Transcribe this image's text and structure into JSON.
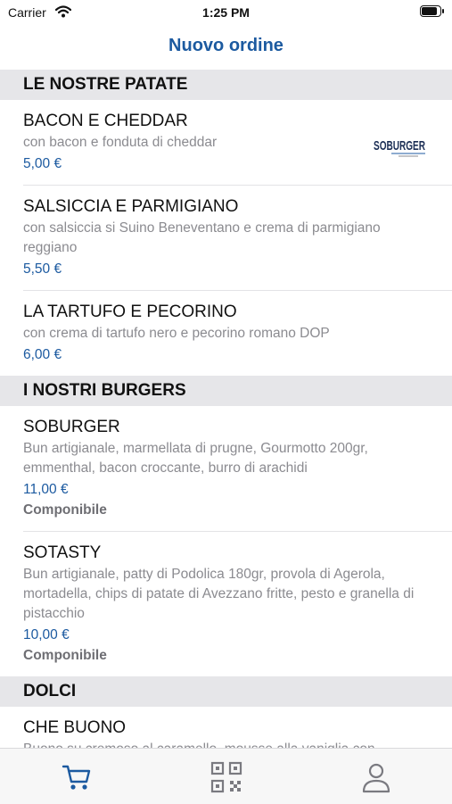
{
  "status": {
    "carrier": "Carrier",
    "time": "1:25 PM"
  },
  "nav": {
    "title": "Nuovo ordine"
  },
  "sections": [
    {
      "title": "LE NOSTRE PATATE",
      "items": [
        {
          "name": "BACON E CHEDDAR",
          "description": "con bacon e fonduta di cheddar",
          "price": "5,00 €",
          "logo": "SOBURGER"
        },
        {
          "name": "SALSICCIA E PARMIGIANO",
          "description": "con salsiccia si Suino Beneventano e crema di parmigiano reggiano",
          "price": "5,50 €"
        },
        {
          "name": "LA TARTUFO E PECORINO",
          "description": "con crema di tartufo nero e pecorino romano DOP",
          "price": "6,00 €"
        }
      ]
    },
    {
      "title": "I NOSTRI BURGERS",
      "items": [
        {
          "name": "SOBURGER",
          "description": "Bun artigianale, marmellata di prugne, Gourmotto 200gr, emmenthal, bacon croccante, burro di arachidi",
          "price": "11,00 €",
          "extra": "Componibile"
        },
        {
          "name": "SOTASTY",
          "description": "Bun artigianale, patty di Podolica 180gr, provola di Agerola, mortadella, chips di patate di Avezzano fritte, pesto e granella di pistacchio",
          "price": "10,00 €",
          "extra": "Componibile"
        }
      ]
    },
    {
      "title": "DOLCI",
      "items": [
        {
          "name": "CHE BUONO",
          "description": "Buono su cremoso al caramello, mousse alla vaniglia con"
        }
      ]
    }
  ],
  "tabs": [
    {
      "icon": "cart-icon",
      "selected": true
    },
    {
      "icon": "qr-code-icon",
      "selected": false
    },
    {
      "icon": "user-icon",
      "selected": false
    }
  ],
  "colors": {
    "accent": "#1c5aa0",
    "section_bg": "#e6e6e9",
    "secondary_text": "#8b8b90"
  }
}
